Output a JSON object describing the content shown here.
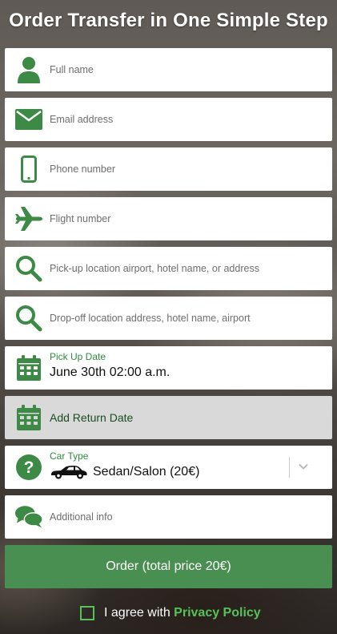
{
  "title": "Order Transfer in One Simple Step",
  "fields": {
    "full_name": {
      "placeholder": "Full name",
      "icon": "person-icon"
    },
    "email": {
      "placeholder": "Email address",
      "icon": "envelope-icon"
    },
    "phone": {
      "placeholder": "Phone number",
      "icon": "phone-icon"
    },
    "flight": {
      "placeholder": "Flight number",
      "icon": "airplane-icon"
    },
    "pickup": {
      "placeholder": "Pick-up location airport, hotel name, or address",
      "icon": "search-icon"
    },
    "dropoff": {
      "placeholder": "Drop-off location address, hotel name, airport",
      "icon": "search-icon"
    },
    "pickup_date": {
      "label": "Pick Up Date",
      "value": "June 30th 02:00 a.m.",
      "icon": "calendar-icon"
    },
    "return_date": {
      "label": "Add Return Date",
      "icon": "calendar-icon"
    },
    "car_type": {
      "label": "Car Type",
      "value": "Sedan/Salon (20€)",
      "icon": "question-icon",
      "car_icon": "car-icon"
    },
    "additional": {
      "placeholder": "Additional info",
      "icon": "chat-icon"
    }
  },
  "order_button": "Order (total price 20€)",
  "agree": {
    "text": "I agree with",
    "link": "Privacy Policy"
  },
  "colors": {
    "accent": "#4a8f52",
    "icon_green": "#3c8a46",
    "link_green": "#56c25a",
    "label_green": "#2e8b3e"
  }
}
